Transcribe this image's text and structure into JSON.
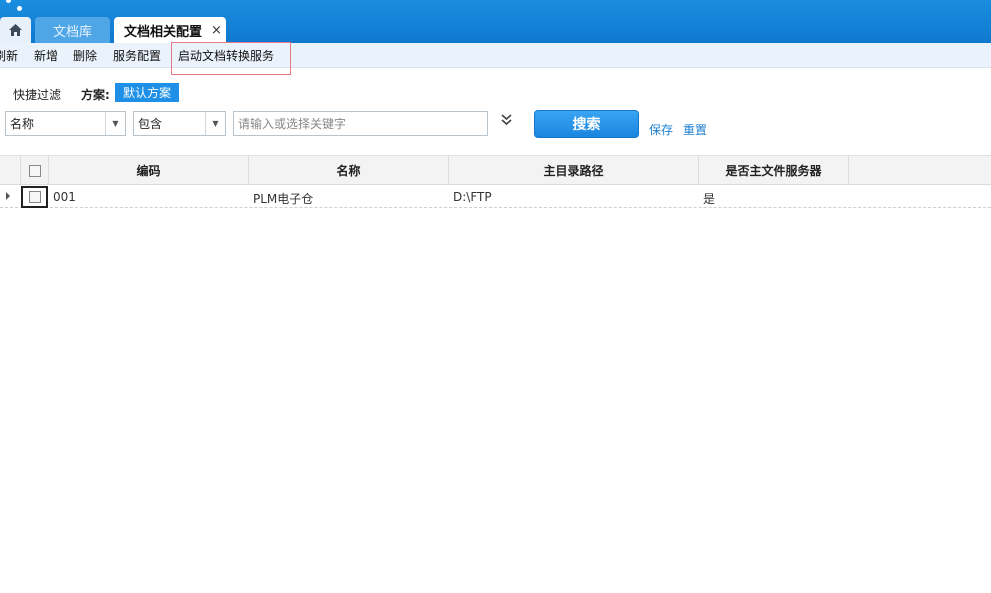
{
  "tabs": {
    "home_icon": "home-icon",
    "items": [
      {
        "label": "文档库"
      },
      {
        "label": "文档相关配置",
        "close": "×"
      }
    ]
  },
  "toolbar": {
    "items": [
      {
        "label": "刷新"
      },
      {
        "label": "新增"
      },
      {
        "label": "删除"
      },
      {
        "label": "服务配置"
      },
      {
        "label": "启动文档转换服务"
      }
    ]
  },
  "filter": {
    "quick_filter_label": "快捷过滤",
    "scheme_label": "方案:",
    "scheme_value": "默认方案",
    "field_select": "名称",
    "operator_select": "包含",
    "keyword_placeholder": "请输入或选择关键字",
    "search_label": "搜索",
    "save_label": "保存",
    "reset_label": "重置"
  },
  "grid": {
    "columns": [
      "编码",
      "名称",
      "主目录路径",
      "是否主文件服务器"
    ],
    "rows": [
      {
        "code": "001",
        "name": "PLM电子仓",
        "path": "D:\\FTP",
        "is_main": "是"
      }
    ]
  },
  "colors": {
    "top_bar": "#1a8ee0",
    "accent": "#1e90e8",
    "toolbar_bg": "#eaf3fc",
    "highlight_border": "#e87b85"
  }
}
